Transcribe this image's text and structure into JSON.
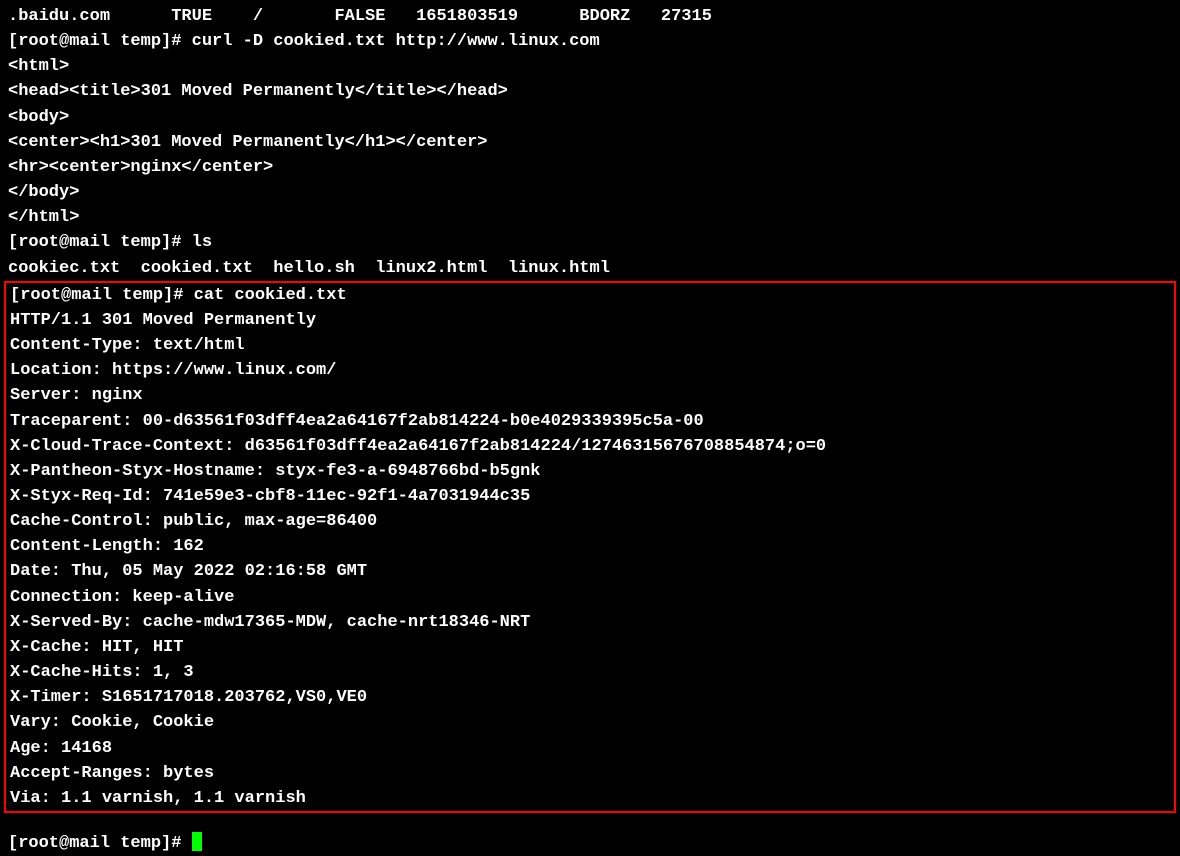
{
  "preamble": {
    "line0": ".baidu.com      TRUE    /       FALSE   1651803519      BDORZ   27315",
    "prompt1": "[root@mail temp]# curl -D cookied.txt http://www.linux.com",
    "html_open": "<html>",
    "head": "<head><title>301 Moved Permanently</title></head>",
    "body_open": "<body>",
    "center_h1": "<center><h1>301 Moved Permanently</h1></center>",
    "hr_center": "<hr><center>nginx</center>",
    "body_close": "</body>",
    "html_close": "</html>",
    "prompt2": "[root@mail temp]# ls",
    "ls_output": "cookiec.txt  cookied.txt  hello.sh  linux2.html  linux.html"
  },
  "box": {
    "prompt3": "[root@mail temp]# cat cookied.txt",
    "http_status": "HTTP/1.1 301 Moved Permanently",
    "content_type": "Content-Type: text/html",
    "location": "Location: https://www.linux.com/",
    "server": "Server: nginx",
    "traceparent": "Traceparent: 00-d63561f03dff4ea2a64167f2ab814224-b0e4029339395c5a-00",
    "x_cloud_trace": "X-Cloud-Trace-Context: d63561f03dff4ea2a64167f2ab814224/12746315676708854874;o=0",
    "x_pantheon": "X-Pantheon-Styx-Hostname: styx-fe3-a-6948766bd-b5gnk",
    "x_styx_req": "X-Styx-Req-Id: 741e59e3-cbf8-11ec-92f1-4a7031944c35",
    "cache_control": "Cache-Control: public, max-age=86400",
    "content_length": "Content-Length: 162",
    "date": "Date: Thu, 05 May 2022 02:16:58 GMT",
    "connection": "Connection: keep-alive",
    "x_served_by": "X-Served-By: cache-mdw17365-MDW, cache-nrt18346-NRT",
    "x_cache": "X-Cache: HIT, HIT",
    "x_cache_hits": "X-Cache-Hits: 1, 3",
    "x_timer": "X-Timer: S1651717018.203762,VS0,VE0",
    "vary": "Vary: Cookie, Cookie",
    "age": "Age: 14168",
    "accept_ranges": "Accept-Ranges: bytes",
    "via": "Via: 1.1 varnish, 1.1 varnish"
  },
  "footer": {
    "prompt4": "[root@mail temp]# "
  }
}
